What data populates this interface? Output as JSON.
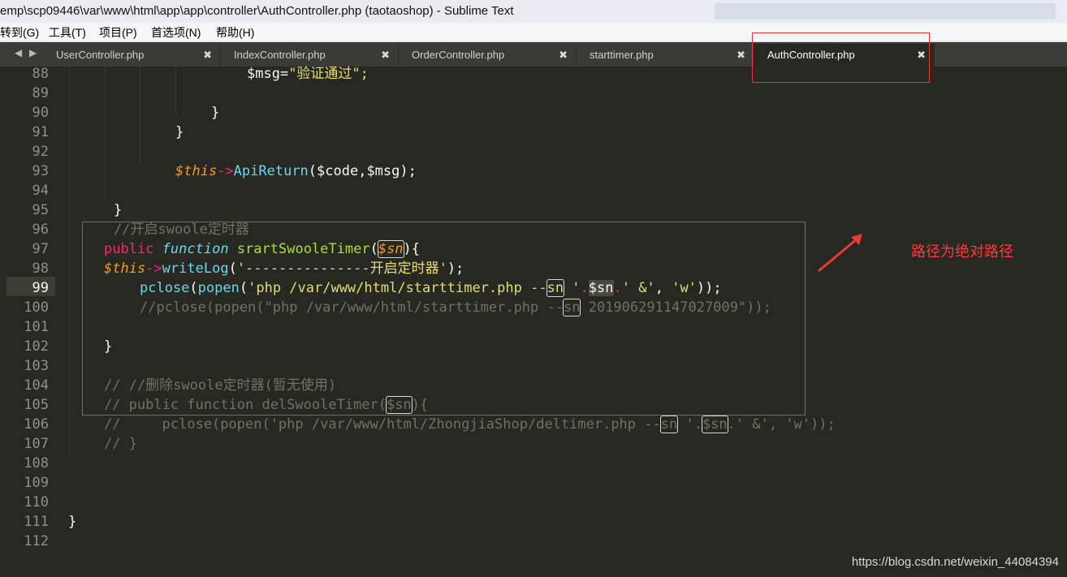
{
  "window": {
    "title": "emp\\scp09446\\var\\www\\html\\app\\app\\controller\\AuthController.php (taotaoshop) - Sublime Text"
  },
  "menu": {
    "items": [
      "转到(G)",
      "工具(T)",
      "项目(P)",
      "首选项(N)",
      "帮助(H)"
    ]
  },
  "tabs": [
    {
      "label": "UserController.php",
      "active": false
    },
    {
      "label": "IndexController.php",
      "active": false
    },
    {
      "label": "OrderController.php",
      "active": false
    },
    {
      "label": "starttimer.php",
      "active": false
    },
    {
      "label": "AuthController.php",
      "active": true
    }
  ],
  "editor": {
    "active_line": 99,
    "line_numbers": [
      "88",
      "89",
      "90",
      "91",
      "92",
      "93",
      "94",
      "95",
      "96",
      "97",
      "98",
      "99",
      "100",
      "101",
      "102",
      "103",
      "104",
      "105",
      "106",
      "107",
      "108",
      "109",
      "110",
      "111",
      "112"
    ],
    "lines": {
      "l88_var": "$msg=",
      "l88_str": "\"验证通过\";",
      "l90": "}",
      "l91": "}",
      "l93_this": "$this",
      "l93_arrow": "->",
      "l93_fn": "ApiReturn",
      "l93_rest": "($code,$msg);",
      "l95": "}",
      "l96": "//开启swoole定时器",
      "l97_kw": "public",
      "l97_fn": "function",
      "l97_name": "srartSwooleTimer",
      "l97_open": "(",
      "l97_param": "$sn",
      "l97_close": "){",
      "l98_this": "$this",
      "l98_arrow": "->",
      "l98_fn": "writeLog",
      "l98_open": "(",
      "l98_str": "'---------------开启定时器'",
      "l98_close": ");",
      "l99_pclose": "pclose",
      "l99_open1": "(",
      "l99_popen": "popen",
      "l99_open2": "(",
      "l99_str1": "'php /var/www/html/starttimer.php --",
      "l99_sn1": "sn",
      "l99_str1b": " '",
      "l99_dot1": ".",
      "l99_sn2": "$sn",
      "l99_dot2": ".",
      "l99_str2": "' &'",
      "l99_comma": ", ",
      "l99_str3": "'w'",
      "l99_close": "));",
      "l100_a": "//pclose(popen(\"php /var/www/html/starttimer.php --",
      "l100_sn": "sn",
      "l100_b": " 201906291147027009\"));",
      "l102": "}",
      "l104": "// //删除swoole定时器(暂无使用)",
      "l105_a": "// public function delSwooleTimer(",
      "l105_sn": "$sn",
      "l105_b": "){",
      "l106_a": "//     pclose(popen('php /var/www/html/ZhongjiaShop/deltimer.php --",
      "l106_sn1": "sn",
      "l106_b": " '.",
      "l106_sn2": "$sn",
      "l106_c": ".' &', 'w'));",
      "l107": "// }",
      "l111": "}"
    }
  },
  "annotation": {
    "text": "路径为绝对路径",
    "color": "#e53b3b"
  },
  "watermark": "https://blog.csdn.net/weixin_44084394"
}
